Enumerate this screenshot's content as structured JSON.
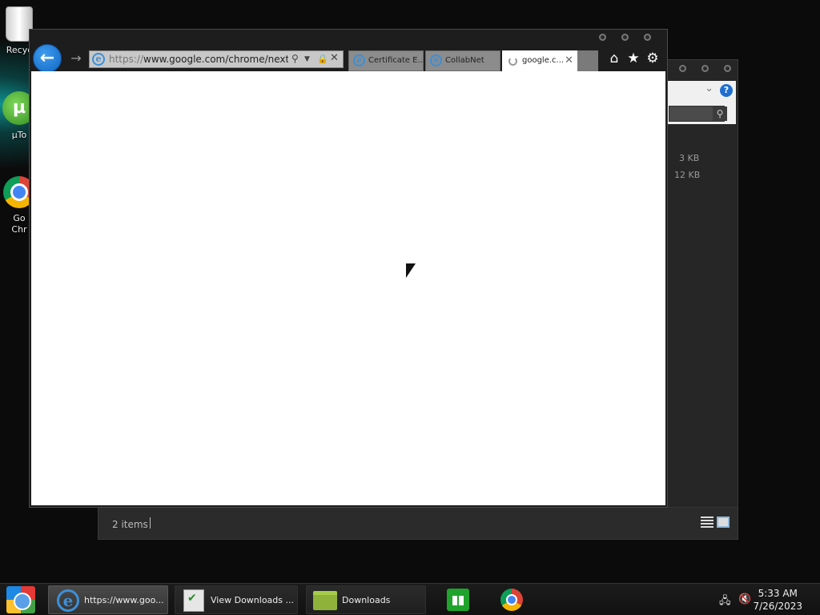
{
  "desktop": {
    "icons": [
      {
        "label": "Recyc"
      },
      {
        "label": "µTo"
      },
      {
        "label_line1": "Go",
        "label_line2": "Chr"
      }
    ]
  },
  "explorer": {
    "sizes": [
      "3 KB",
      "12 KB"
    ],
    "status": "2 items",
    "help": "?"
  },
  "ie": {
    "url": {
      "prefix": "https://",
      "host": "www.google.com",
      "path": "/chrome/next-ste"
    },
    "tabs": [
      {
        "label": "Certificate E...",
        "active": false
      },
      {
        "label": "CollabNet",
        "active": false
      },
      {
        "label": "google.c...",
        "active": true
      }
    ]
  },
  "taskbar": {
    "buttons": [
      {
        "label": "https://www.goo..."
      },
      {
        "label": "View Downloads ..."
      },
      {
        "label": "Downloads"
      }
    ],
    "clock": {
      "time": "5:33 AM",
      "date": "7/26/2023"
    }
  },
  "colors": {
    "accent": "#1e6fd0",
    "window_bg": "#1d1d1d",
    "page_bg": "#ffffff"
  }
}
